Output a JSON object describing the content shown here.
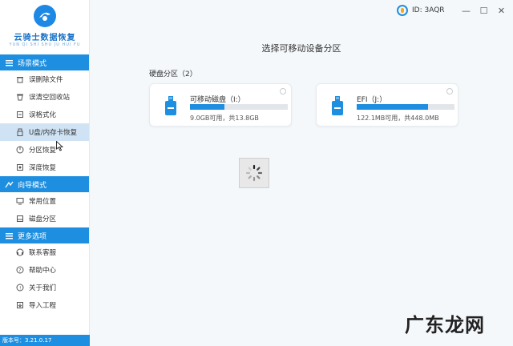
{
  "app": {
    "title": "云骑士数据恢复",
    "subtitle": "YUN QI SHI SHU JU HUI FU",
    "version": "版本号：3.21.0.17"
  },
  "titlebar": {
    "id_label": "ID: 3AQR",
    "minimize_label": "—",
    "maximize_label": "☐",
    "close_label": "✕"
  },
  "sidebar": {
    "sections": [
      {
        "title": "场景模式",
        "items": [
          "误删除文件",
          "误清空回收站",
          "误格式化",
          "U盘/内存卡恢复",
          "分区恢复",
          "深度恢复"
        ]
      },
      {
        "title": "向导模式",
        "items": [
          "常用位置",
          "磁盘分区"
        ]
      },
      {
        "title": "更多选项",
        "items": [
          "联系客服",
          "帮助中心",
          "关于我们",
          "导入工程"
        ]
      }
    ],
    "active_item": "U盘/内存卡恢复"
  },
  "main": {
    "title": "选择可移动设备分区",
    "section_label": "硬盘分区（2）",
    "drives": [
      {
        "name": "可移动磁盘（I:）",
        "info": "9.0GB可用，共13.8GB",
        "used_fraction": 0.35
      },
      {
        "name": "EFI（J:）",
        "info": "122.1MB可用，共448.0MB",
        "used_fraction": 0.73
      }
    ]
  },
  "watermark": "广东龙网",
  "colors": {
    "accent": "#1e8fe0",
    "active_bg": "#cfe3f5"
  }
}
